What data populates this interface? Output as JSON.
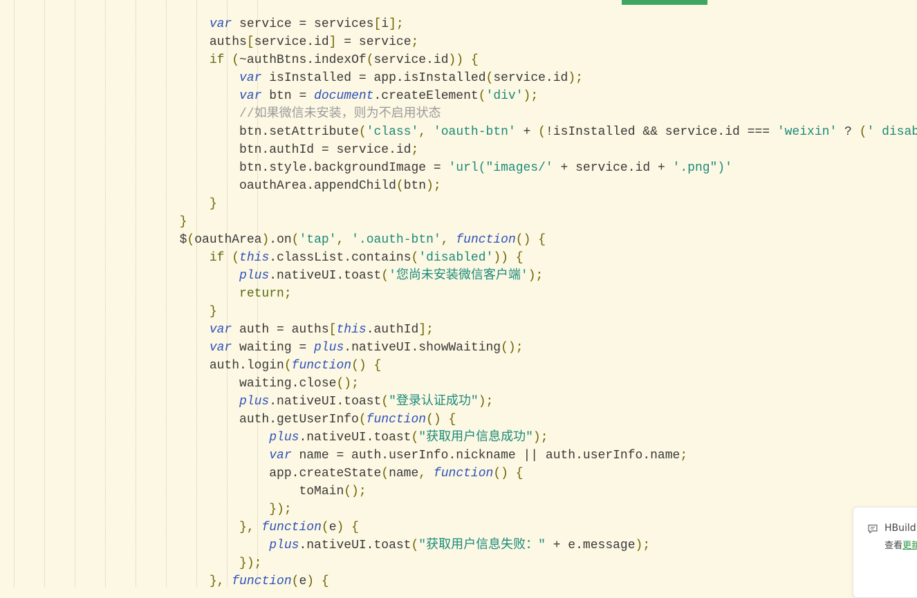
{
  "editor": {
    "colors": {
      "background": "#fdf8e3",
      "keyword": "#2d51b9",
      "string": "#1b8a7a",
      "comment": "#9b9b9b",
      "punctuation": "#6e6200",
      "accent_bar": "#3fa661"
    },
    "lines": [
      [
        [
          "",
          "      "
        ],
        [
          "kw",
          "var"
        ],
        [
          "id",
          " service = services"
        ],
        [
          "punc",
          "["
        ],
        [
          "id",
          "i"
        ],
        [
          "punc",
          "];"
        ]
      ],
      [
        [
          "",
          "      "
        ],
        [
          "id",
          "auths"
        ],
        [
          "punc",
          "["
        ],
        [
          "id",
          "service.id"
        ],
        [
          "punc",
          "]"
        ],
        [
          "id",
          " = service"
        ],
        [
          "punc",
          ";"
        ]
      ],
      [
        [
          "",
          "      "
        ],
        [
          "cf",
          "if"
        ],
        [
          "id",
          " "
        ],
        [
          "punc",
          "("
        ],
        [
          "id",
          "~authBtns.indexOf"
        ],
        [
          "punc",
          "("
        ],
        [
          "id",
          "service.id"
        ],
        [
          "punc",
          "))"
        ],
        [
          "id",
          " "
        ],
        [
          "punc",
          "{"
        ]
      ],
      [
        [
          "",
          "          "
        ],
        [
          "kw",
          "var"
        ],
        [
          "id",
          " isInstalled = app.isInstalled"
        ],
        [
          "punc",
          "("
        ],
        [
          "id",
          "service.id"
        ],
        [
          "punc",
          ");"
        ]
      ],
      [
        [
          "",
          "          "
        ],
        [
          "kw",
          "var"
        ],
        [
          "id",
          " btn = "
        ],
        [
          "kw",
          "document"
        ],
        [
          "id",
          ".createElement"
        ],
        [
          "punc",
          "("
        ],
        [
          "str",
          "'div'"
        ],
        [
          "punc",
          ");"
        ]
      ],
      [
        [
          "",
          "          "
        ],
        [
          "cmt",
          "//如果微信未安装，则为不启用状态"
        ]
      ],
      [
        [
          "",
          "          "
        ],
        [
          "id",
          "btn.setAttribute"
        ],
        [
          "punc",
          "("
        ],
        [
          "str",
          "'class'"
        ],
        [
          "punc",
          ","
        ],
        [
          "id",
          " "
        ],
        [
          "str",
          "'oauth-btn'"
        ],
        [
          "id",
          " + "
        ],
        [
          "punc",
          "("
        ],
        [
          "id",
          "!isInstalled && service.id === "
        ],
        [
          "str",
          "'weixin'"
        ],
        [
          "id",
          " ? "
        ],
        [
          "punc",
          "("
        ],
        [
          "str",
          "' disab"
        ]
      ],
      [
        [
          "",
          "          "
        ],
        [
          "id",
          "btn.authId = service.id"
        ],
        [
          "punc",
          ";"
        ]
      ],
      [
        [
          "",
          "          "
        ],
        [
          "id",
          "btn.style.backgroundImage = "
        ],
        [
          "str",
          "'url(\"images/'"
        ],
        [
          "id",
          " + service.id + "
        ],
        [
          "str",
          "'.png\")'"
        ]
      ],
      [
        [
          "",
          "          "
        ],
        [
          "id",
          "oauthArea.appendChild"
        ],
        [
          "punc",
          "("
        ],
        [
          "id",
          "btn"
        ],
        [
          "punc",
          ");"
        ]
      ],
      [
        [
          "",
          "      "
        ],
        [
          "punc",
          "}"
        ]
      ],
      [
        [
          "",
          "  "
        ],
        [
          "punc",
          "}"
        ]
      ],
      [
        [
          "",
          "  "
        ],
        [
          "id",
          "$"
        ],
        [
          "punc",
          "("
        ],
        [
          "id",
          "oauthArea"
        ],
        [
          "punc",
          ")"
        ],
        [
          "id",
          ".on"
        ],
        [
          "punc",
          "("
        ],
        [
          "str",
          "'tap'"
        ],
        [
          "punc",
          ","
        ],
        [
          "id",
          " "
        ],
        [
          "str",
          "'.oauth-btn'"
        ],
        [
          "punc",
          ","
        ],
        [
          "id",
          " "
        ],
        [
          "kw",
          "function"
        ],
        [
          "punc",
          "()"
        ],
        [
          "id",
          " "
        ],
        [
          "punc",
          "{"
        ]
      ],
      [
        [
          "",
          "      "
        ],
        [
          "cf",
          "if"
        ],
        [
          "id",
          " "
        ],
        [
          "punc",
          "("
        ],
        [
          "kw",
          "this"
        ],
        [
          "id",
          ".classList.contains"
        ],
        [
          "punc",
          "("
        ],
        [
          "str",
          "'disabled'"
        ],
        [
          "punc",
          "))"
        ],
        [
          "id",
          " "
        ],
        [
          "punc",
          "{"
        ]
      ],
      [
        [
          "",
          "          "
        ],
        [
          "kw",
          "plus"
        ],
        [
          "id",
          ".nativeUI.toast"
        ],
        [
          "punc",
          "("
        ],
        [
          "str",
          "'您尚未安装微信客户端'"
        ],
        [
          "punc",
          ");"
        ]
      ],
      [
        [
          "",
          "          "
        ],
        [
          "cf",
          "return"
        ],
        [
          "punc",
          ";"
        ]
      ],
      [
        [
          "",
          "      "
        ],
        [
          "punc",
          "}"
        ]
      ],
      [
        [
          "",
          "      "
        ],
        [
          "kw",
          "var"
        ],
        [
          "id",
          " auth = auths"
        ],
        [
          "punc",
          "["
        ],
        [
          "kw",
          "this"
        ],
        [
          "id",
          ".authId"
        ],
        [
          "punc",
          "];"
        ]
      ],
      [
        [
          "",
          "      "
        ],
        [
          "kw",
          "var"
        ],
        [
          "id",
          " waiting = "
        ],
        [
          "kw",
          "plus"
        ],
        [
          "id",
          ".nativeUI.showWaiting"
        ],
        [
          "punc",
          "();"
        ]
      ],
      [
        [
          "",
          "      "
        ],
        [
          "id",
          "auth.login"
        ],
        [
          "punc",
          "("
        ],
        [
          "kw",
          "function"
        ],
        [
          "punc",
          "()"
        ],
        [
          "id",
          " "
        ],
        [
          "punc",
          "{"
        ]
      ],
      [
        [
          "",
          "          "
        ],
        [
          "id",
          "waiting.close"
        ],
        [
          "punc",
          "();"
        ]
      ],
      [
        [
          "",
          "          "
        ],
        [
          "kw",
          "plus"
        ],
        [
          "id",
          ".nativeUI.toast"
        ],
        [
          "punc",
          "("
        ],
        [
          "str",
          "\"登录认证成功\""
        ],
        [
          "punc",
          ");"
        ]
      ],
      [
        [
          "",
          "          "
        ],
        [
          "id",
          "auth.getUserInfo"
        ],
        [
          "punc",
          "("
        ],
        [
          "kw",
          "function"
        ],
        [
          "punc",
          "()"
        ],
        [
          "id",
          " "
        ],
        [
          "punc",
          "{"
        ]
      ],
      [
        [
          "",
          "              "
        ],
        [
          "kw",
          "plus"
        ],
        [
          "id",
          ".nativeUI.toast"
        ],
        [
          "punc",
          "("
        ],
        [
          "str",
          "\"获取用户信息成功\""
        ],
        [
          "punc",
          ");"
        ]
      ],
      [
        [
          "",
          "              "
        ],
        [
          "kw",
          "var"
        ],
        [
          "id",
          " name = auth.userInfo.nickname || auth.userInfo.name"
        ],
        [
          "punc",
          ";"
        ]
      ],
      [
        [
          "",
          "              "
        ],
        [
          "id",
          "app.createState"
        ],
        [
          "punc",
          "("
        ],
        [
          "id",
          "name"
        ],
        [
          "punc",
          ","
        ],
        [
          "id",
          " "
        ],
        [
          "kw",
          "function"
        ],
        [
          "punc",
          "()"
        ],
        [
          "id",
          " "
        ],
        [
          "punc",
          "{"
        ]
      ],
      [
        [
          "",
          "                  "
        ],
        [
          "id",
          "toMain"
        ],
        [
          "punc",
          "();"
        ]
      ],
      [
        [
          "",
          "              "
        ],
        [
          "punc",
          "});"
        ]
      ],
      [
        [
          "",
          "          "
        ],
        [
          "punc",
          "},"
        ],
        [
          "id",
          " "
        ],
        [
          "kw",
          "function"
        ],
        [
          "punc",
          "("
        ],
        [
          "id",
          "e"
        ],
        [
          "punc",
          ")"
        ],
        [
          "id",
          " "
        ],
        [
          "punc",
          "{"
        ]
      ],
      [
        [
          "",
          "              "
        ],
        [
          "kw",
          "plus"
        ],
        [
          "id",
          ".nativeUI.toast"
        ],
        [
          "punc",
          "("
        ],
        [
          "str",
          "\"获取用户信息失败：\""
        ],
        [
          "id",
          " + e.message"
        ],
        [
          "punc",
          ");"
        ]
      ],
      [
        [
          "",
          "          "
        ],
        [
          "punc",
          "});"
        ]
      ],
      [
        [
          "",
          "      "
        ],
        [
          "punc",
          "},"
        ],
        [
          "id",
          " "
        ],
        [
          "kw",
          "function"
        ],
        [
          "punc",
          "("
        ],
        [
          "id",
          "e"
        ],
        [
          "punc",
          ")"
        ],
        [
          "id",
          " "
        ],
        [
          "punc",
          "{"
        ]
      ]
    ]
  },
  "notification": {
    "icon": "comment-icon",
    "title": "HBuild",
    "body_prefix": "查看",
    "link": "更新"
  }
}
